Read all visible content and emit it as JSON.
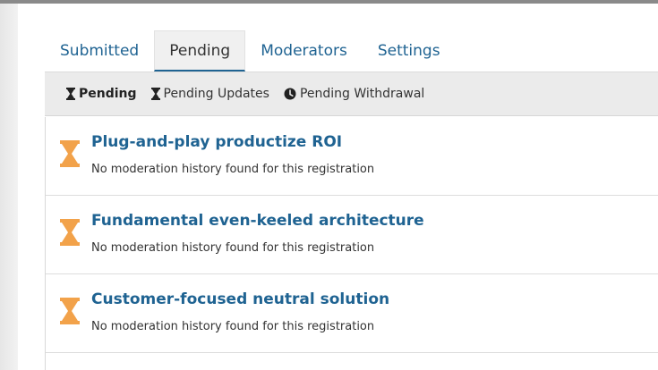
{
  "tabs": [
    {
      "label": "Submitted"
    },
    {
      "label": "Pending"
    },
    {
      "label": "Moderators"
    },
    {
      "label": "Settings"
    }
  ],
  "active_tab": "Pending",
  "filters": [
    {
      "label": "Pending",
      "icon": "hourglass-icon"
    },
    {
      "label": "Pending Updates",
      "icon": "hourglass-icon"
    },
    {
      "label": "Pending Withdrawal",
      "icon": "clock-icon"
    }
  ],
  "registrations": [
    {
      "title": "Plug-and-play productize ROI",
      "status_text": "No moderation history found for this registration",
      "icon": "hourglass-icon"
    },
    {
      "title": "Fundamental even-keeled architecture",
      "status_text": "No moderation history found for this registration",
      "icon": "hourglass-icon"
    },
    {
      "title": "Customer-focused neutral solution",
      "status_text": "No moderation history found for this registration",
      "icon": "hourglass-icon"
    }
  ],
  "colors": {
    "link": "#1f6392",
    "pending_icon": "#f2a24a",
    "filter_bar": "#ebebeb"
  }
}
